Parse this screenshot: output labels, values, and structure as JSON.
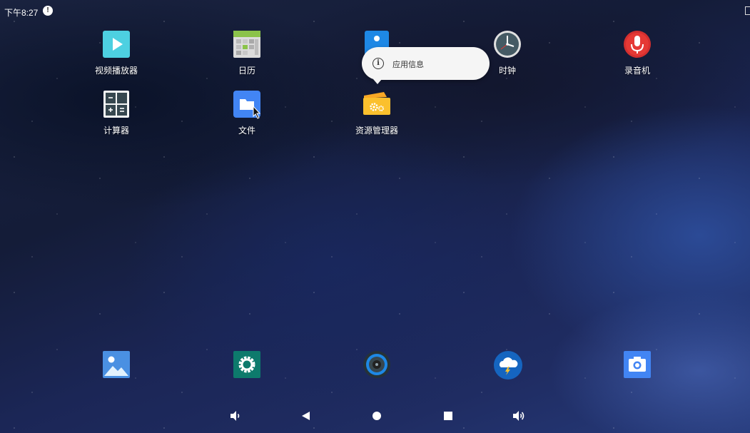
{
  "status_bar": {
    "time": "下午8:27",
    "notification_icon": "notification-badge-icon"
  },
  "apps": [
    {
      "id": "video-player",
      "label": "视频播放器",
      "icon": "play-icon"
    },
    {
      "id": "calendar",
      "label": "日历",
      "icon": "calendar-icon"
    },
    {
      "id": "contacts",
      "label": "",
      "icon": "contacts-icon"
    },
    {
      "id": "clock",
      "label": "时钟",
      "icon": "clock-icon"
    },
    {
      "id": "recorder",
      "label": "录音机",
      "icon": "microphone-icon"
    },
    {
      "id": "calculator",
      "label": "计算器",
      "icon": "calculator-icon"
    },
    {
      "id": "files",
      "label": "文件",
      "icon": "folder-icon"
    },
    {
      "id": "file-manager",
      "label": "资源管理器",
      "icon": "file-manager-icon"
    }
  ],
  "popup": {
    "label": "应用信息",
    "icon": "info-icon"
  },
  "dock": [
    {
      "id": "gallery",
      "icon": "gallery-icon"
    },
    {
      "id": "settings",
      "icon": "settings-gear-icon"
    },
    {
      "id": "music",
      "icon": "speaker-icon"
    },
    {
      "id": "weather",
      "icon": "weather-icon"
    },
    {
      "id": "camera",
      "icon": "camera-icon"
    }
  ],
  "nav_bar": [
    {
      "id": "volume-down",
      "icon": "volume-down-icon"
    },
    {
      "id": "back",
      "icon": "back-triangle-icon"
    },
    {
      "id": "home",
      "icon": "home-circle-icon"
    },
    {
      "id": "recents",
      "icon": "recents-square-icon"
    },
    {
      "id": "volume-up",
      "icon": "volume-up-icon"
    }
  ],
  "colors": {
    "video_player": "#4dd0e1",
    "calendar": "#8bc34a",
    "contacts": "#1e88e5",
    "recorder": "#d32f2f",
    "files": "#4285f4",
    "file_manager": "#fbc02d",
    "settings": "#0d7a6c",
    "weather": "#1565c0",
    "camera": "#4285f4",
    "gallery": "#4a90e2"
  }
}
